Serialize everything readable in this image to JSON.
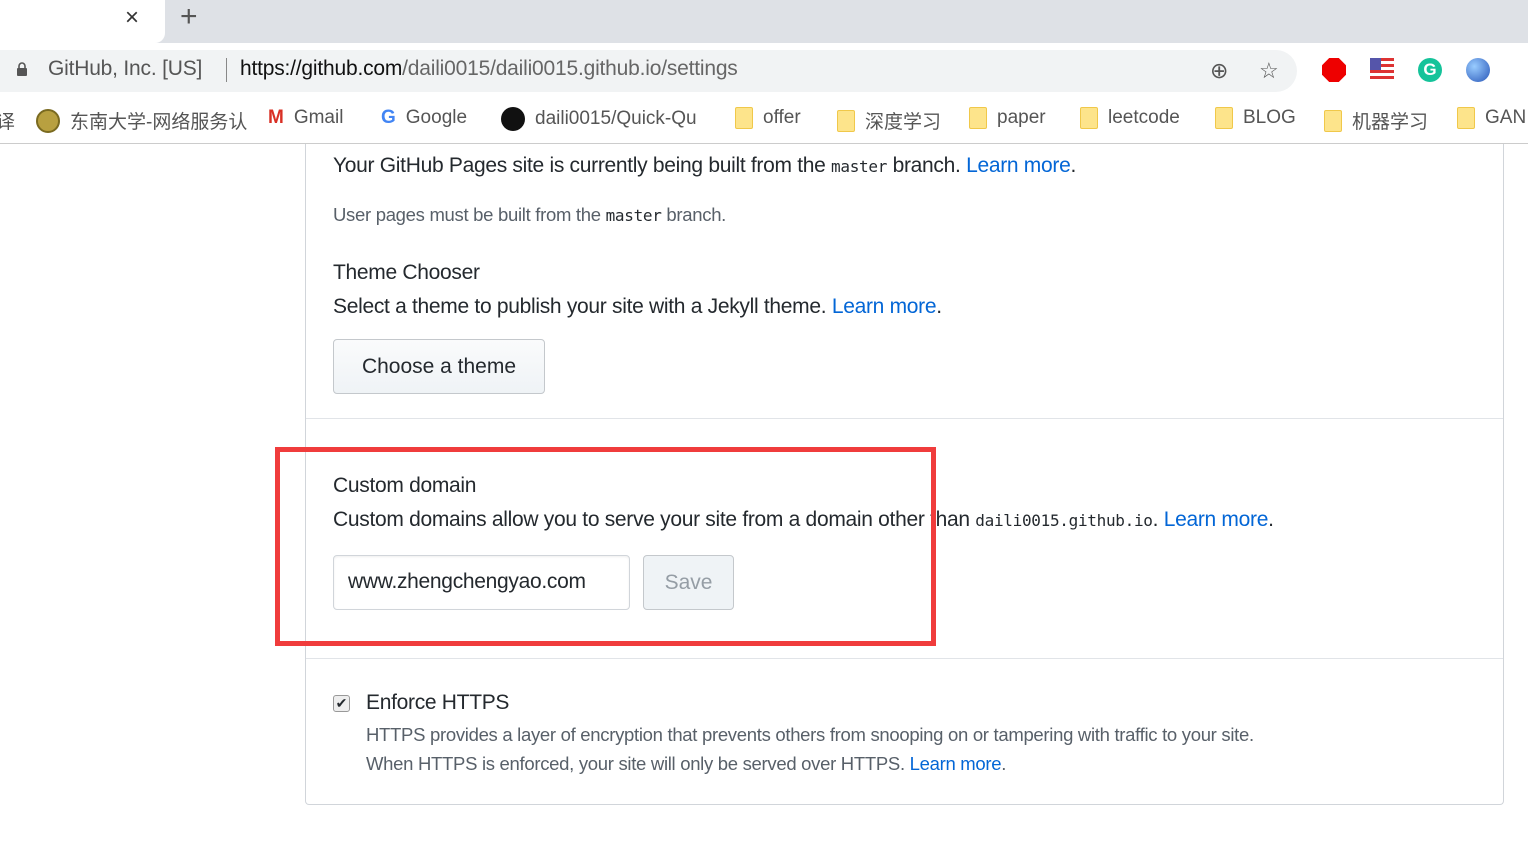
{
  "browser": {
    "tab_close": "×",
    "new_tab": "+",
    "site_identity": "GitHub, Inc. [US]",
    "url_host": "https://github.com",
    "url_path": "/daili0015/daili0015.github.io/settings",
    "icons": [
      "lock-icon",
      "zoom-icon",
      "star-icon",
      "adblock-icon",
      "flag-extension-icon",
      "grammarly-icon",
      "globe-extension-icon"
    ],
    "bookmarks": [
      {
        "label": "译",
        "icon": "none"
      },
      {
        "label": "东南大学-网络服务认",
        "icon": "seu-icon"
      },
      {
        "label": "Gmail",
        "icon": "gmail-icon"
      },
      {
        "label": "Google",
        "icon": "google-icon"
      },
      {
        "label": "daili0015/Quick-Qu",
        "icon": "github-icon"
      },
      {
        "label": "offer",
        "icon": "folder-icon"
      },
      {
        "label": "深度学习",
        "icon": "folder-icon"
      },
      {
        "label": "paper",
        "icon": "folder-icon"
      },
      {
        "label": "leetcode",
        "icon": "folder-icon"
      },
      {
        "label": "BLOG",
        "icon": "folder-icon"
      },
      {
        "label": "机器学习",
        "icon": "folder-icon"
      },
      {
        "label": "GAN",
        "icon": "folder-icon"
      }
    ]
  },
  "pages": {
    "build_text_a": "Your GitHub Pages site is currently being built from the ",
    "build_branch": "master",
    "build_text_b": " branch. ",
    "learn_more": "Learn more",
    "period": ".",
    "note_a": "User pages must be built from the ",
    "note_branch": "master",
    "note_b": " branch."
  },
  "theme": {
    "title": "Theme Chooser",
    "desc": "Select a theme to publish your site with a Jekyll theme. ",
    "learn_more": "Learn more",
    "button": "Choose a theme"
  },
  "domain": {
    "title": "Custom domain",
    "desc_a": "Custom domains allow you to serve your site from a domain other than ",
    "default_domain": "daili0015.github.io",
    "desc_b": ". ",
    "learn_more": "Learn more",
    "input_value": "www.zhengchengyao.com",
    "save": "Save"
  },
  "https": {
    "title": "Enforce HTTPS",
    "checked": true,
    "line1": "HTTPS provides a layer of encryption that prevents others from snooping on or tampering with traffic to your site.",
    "line2": "When HTTPS is enforced, your site will only be served over HTTPS. ",
    "learn_more": "Learn more"
  },
  "colors": {
    "link": "#0366d6",
    "highlight": "#f03c3c"
  }
}
